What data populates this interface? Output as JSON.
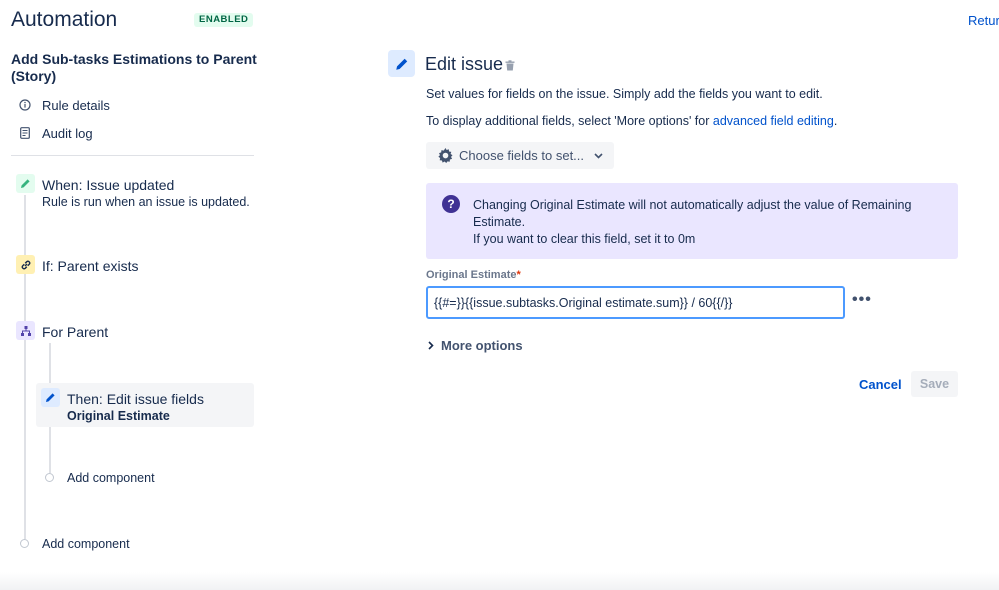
{
  "header": {
    "title": "Automation",
    "status": "ENABLED",
    "return_link": "Retur"
  },
  "sidebar": {
    "rule_name": "Add Sub-tasks Estimations to Parent (Story)",
    "links": [
      {
        "label": "Rule details",
        "icon": "info-icon"
      },
      {
        "label": "Audit log",
        "icon": "audit-log-icon"
      }
    ],
    "steps": {
      "trigger": {
        "title": "When: Issue updated",
        "subtitle": "Rule is run when an issue is updated.",
        "icon": "pencil-icon",
        "color": "#36b37e"
      },
      "condition": {
        "title": "If: Parent exists",
        "icon": "link-icon",
        "color": "#ffe380"
      },
      "branch": {
        "title": "For Parent",
        "icon": "hierarchy-icon",
        "color": "#eae6ff"
      },
      "action": {
        "title": "Then: Edit issue fields",
        "subtitle": "Original Estimate",
        "icon": "pencil-icon",
        "color": "#deebff"
      },
      "add_component_inner": "Add component",
      "add_component_outer": "Add component"
    }
  },
  "panel": {
    "title": "Edit issue",
    "desc1": "Set values for fields on the issue. Simply add the fields you want to edit.",
    "desc2_prefix": "To display additional fields, select 'More options' for ",
    "desc2_link": "advanced field editing",
    "desc2_suffix": ".",
    "choose_fields": "Choose fields to set...",
    "info": {
      "line1": "Changing Original Estimate will not automatically adjust the value of Remaining Estimate.",
      "line2": "If you want to clear this field, set it to 0m"
    },
    "field_label": "Original Estimate",
    "required_mark": "*",
    "field_value": "{{#=}}{{issue.subtasks.Original estimate.sum}} / 60{{/}}",
    "more_options": "More options",
    "cancel": "Cancel",
    "save": "Save"
  },
  "colors": {
    "accent": "#0052cc",
    "enabled_bg": "#e3fcef",
    "enabled_text": "#006644",
    "info_bg": "#eae6ff",
    "info_icon": "#403294"
  }
}
